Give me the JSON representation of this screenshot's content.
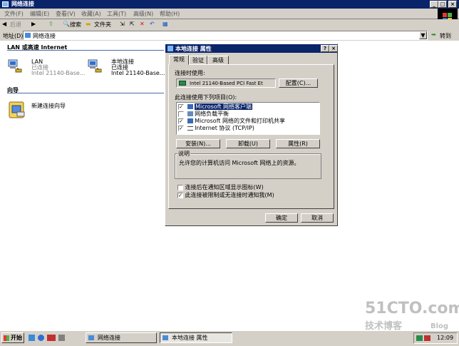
{
  "window": {
    "title": "网络连接"
  },
  "menu": [
    "文件(F)",
    "编辑(E)",
    "查看(V)",
    "收藏(A)",
    "工具(T)",
    "高级(N)",
    "帮助(H)"
  ],
  "toolbar": {
    "back": "后退",
    "search": "搜索",
    "folders": "文件夹"
  },
  "address": {
    "label": "地址(D)",
    "value": "网络连接",
    "go": "转到"
  },
  "groups": {
    "lan": "LAN 或高速 Internet",
    "wizard": "向导"
  },
  "connections": [
    {
      "name": "LAN",
      "status": "已连接",
      "device": "Intel 21140-Base..."
    },
    {
      "name": "本地连接",
      "status": "已连接",
      "device": "Intel 21140-Base..."
    }
  ],
  "wizard_item": "新建连接向导",
  "dialog": {
    "title": "本地连接 属性",
    "help": "?",
    "close": "×",
    "tabs": [
      "常规",
      "验证",
      "高级"
    ],
    "connect_using_label": "连接时使用:",
    "adapter": "Intel 21140-Based PCI Fast Et",
    "configure": "配置(C)...",
    "items_label": "此连接使用下列项目(O):",
    "items": [
      {
        "label": "Microsoft 网络客户端",
        "checked": true
      },
      {
        "label": "网络负载平衡",
        "checked": false
      },
      {
        "label": "Microsoft 网络的文件和打印机共享",
        "checked": true
      },
      {
        "label": "Internet 协议 (TCP/IP)",
        "checked": true
      }
    ],
    "install": "安装(N)...",
    "uninstall": "卸载(U)",
    "properties": "属性(R)",
    "desc_label": "说明",
    "desc_text": "允许您的计算机访问 Microsoft 网络上的资源。",
    "opt1": "连接后在通知区域显示图标(W)",
    "opt2": "此连接被限制或无连接时通知我(M)",
    "ok": "确定",
    "cancel": "取消"
  },
  "taskbar": {
    "start": "开始",
    "tasks": [
      "网络连接",
      "本地连接 属性"
    ],
    "time": "12:09"
  },
  "watermark": {
    "line1": "51CTO.com",
    "line2": "技术博客",
    "blog": "Blog"
  }
}
